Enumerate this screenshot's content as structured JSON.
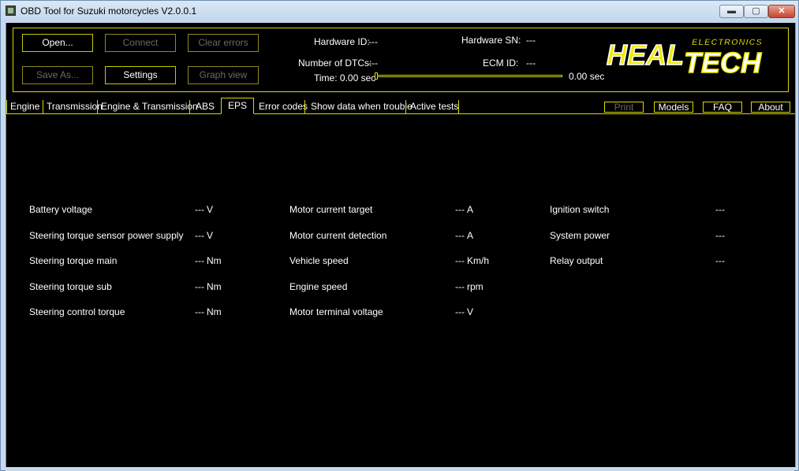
{
  "window": {
    "title": "OBD Tool for Suzuki motorcycles V2.0.0.1",
    "minimize": "▬",
    "maximize": "▢",
    "close": "✕"
  },
  "toolbar": {
    "open": "Open...",
    "connect": "Connect",
    "clear_errors": "Clear errors",
    "save_as": "Save As...",
    "settings": "Settings",
    "graph_view": "Graph view"
  },
  "info": {
    "hardware_id_label": "Hardware ID:",
    "hardware_id_value": "---",
    "hardware_sn_label": "Hardware SN:",
    "hardware_sn_value": "---",
    "dtc_label": "Number of DTCs:",
    "dtc_value": "---",
    "ecm_id_label": "ECM ID:",
    "ecm_id_value": "---",
    "time_label": "Time: 0.00 sec",
    "time_end": "0.00 sec",
    "time_progress": 0
  },
  "logo": {
    "heal": "HEAL",
    "tech": "TECH",
    "electronics": "ELECTRONICS",
    "color": "#f0ea00"
  },
  "tabs": [
    {
      "label": "Engine"
    },
    {
      "label": "Transmission"
    },
    {
      "label": "Engine & Transmission"
    },
    {
      "label": "ABS"
    },
    {
      "label": "EPS"
    },
    {
      "label": "Error codes"
    },
    {
      "label": "Show data when trouble"
    },
    {
      "label": "Active tests"
    }
  ],
  "active_tab": "EPS",
  "right_buttons": {
    "print": "Print",
    "models": "Models",
    "faq": "FAQ",
    "about": "About"
  },
  "params": {
    "col1": [
      {
        "label": "Battery voltage",
        "value": "---",
        "unit": "V"
      },
      {
        "label": "Steering torque sensor power supply",
        "value": "---",
        "unit": "V"
      },
      {
        "label": "Steering torque main",
        "value": "---",
        "unit": "Nm"
      },
      {
        "label": "Steering torque sub",
        "value": "---",
        "unit": "Nm"
      },
      {
        "label": "Steering control torque",
        "value": "---",
        "unit": "Nm"
      }
    ],
    "col2": [
      {
        "label": "Motor current target",
        "value": "---",
        "unit": "A"
      },
      {
        "label": "Motor current detection",
        "value": "---",
        "unit": "A"
      },
      {
        "label": "Vehicle speed",
        "value": "---",
        "unit": "Km/h"
      },
      {
        "label": "Engine speed",
        "value": "---",
        "unit": "rpm"
      },
      {
        "label": "Motor terminal voltage",
        "value": "---",
        "unit": "V"
      }
    ],
    "col3": [
      {
        "label": "Ignition switch",
        "value": "---"
      },
      {
        "label": "System power",
        "value": "---"
      },
      {
        "label": "Relay output",
        "value": "---"
      }
    ]
  }
}
